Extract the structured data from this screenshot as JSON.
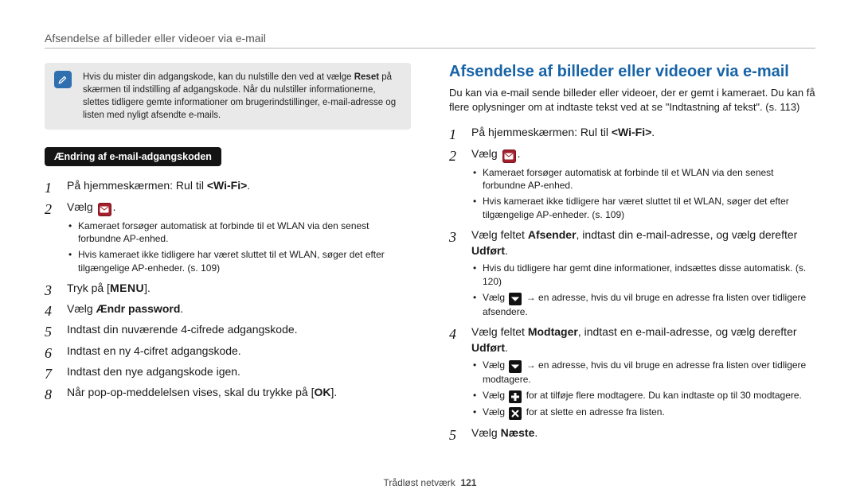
{
  "header": {
    "title": "Afsendelse af billeder eller videoer via e-mail"
  },
  "note": {
    "text": "Hvis du mister din adgangskode, kan du nulstille den ved at vælge ",
    "reset_word": "Reset",
    "text2": " på skærmen til indstilling af adgangskode. Når du nulstiller informationerne, slettes tidligere gemte informationer om brugerindstillinger, e-mail-adresse og listen med nyligt afsendte e-mails."
  },
  "section_pill": "Ændring af e-mail-adgangskoden",
  "left": {
    "s1_a": "På hjemmeskærmen: Rul til ",
    "s1_b": "<Wi-Fi>",
    "s1_c": ".",
    "s2": "Vælg ",
    "s2_suffix": ".",
    "bul1": "Kameraet forsøger automatisk at forbinde til et WLAN via den senest forbundne AP-enhed.",
    "bul2": "Hvis kameraet ikke tidligere har været sluttet til et WLAN, søger det efter tilgængelige AP-enheder. (s. 109)",
    "s3_a": "Tryk på [",
    "s3_menu": "MENU",
    "s3_b": "].",
    "s4_a": "Vælg ",
    "s4_b": "Ændr password",
    "s4_c": ".",
    "s5": "Indtast din nuværende 4-cifrede adgangskode.",
    "s6": "Indtast en ny 4-cifret adgangskode.",
    "s7": "Indtast den nye adgangskode igen.",
    "s8_a": "Når pop-op-meddelelsen vises, skal du trykke på [",
    "s8_ok": "OK",
    "s8_b": "]."
  },
  "right": {
    "heading": "Afsendelse af billeder eller videoer via e-mail",
    "intro": "Du kan via e-mail sende billeder eller videoer, der er gemt i kameraet. Du kan få flere oplysninger om at indtaste tekst ved at se \"Indtastning af tekst\". (s. 113)",
    "s1_a": "På hjemmeskærmen: Rul til ",
    "s1_b": "<Wi-Fi>",
    "s1_c": ".",
    "s2": "Vælg ",
    "s2_suffix": ".",
    "bul1": "Kameraet forsøger automatisk at forbinde til et WLAN via den senest forbundne AP-enhed.",
    "bul2": "Hvis kameraet ikke tidligere har været sluttet til et WLAN, søger det efter tilgængelige AP-enheder. (s. 109)",
    "s3_a": "Vælg feltet ",
    "s3_b": "Afsender",
    "s3_c": ", indtast din e-mail-adresse, og vælg derefter ",
    "s3_d": "Udført",
    "s3_e": ".",
    "s3_bul1": "Hvis du tidligere har gemt dine informationer, indsættes disse automatisk. (s. 120)",
    "s3_bul2a": "Vælg ",
    "s3_bul2b": " → en adresse, hvis du vil bruge en adresse fra listen over tidligere afsendere.",
    "s4_a": "Vælg feltet ",
    "s4_b": "Modtager",
    "s4_c": ", indtast en e-mail-adresse, og vælg derefter ",
    "s4_d": "Udført",
    "s4_e": ".",
    "s4_bul1a": "Vælg ",
    "s4_bul1b": " → en adresse, hvis du vil bruge en adresse fra listen over tidligere modtagere.",
    "s4_bul2a": "Vælg ",
    "s4_bul2b": " for at tilføje flere modtagere. Du kan indtaste op til 30 modtagere.",
    "s4_bul3a": "Vælg ",
    "s4_bul3b": " for at slette en adresse fra listen.",
    "s5_a": "Vælg ",
    "s5_b": "Næste",
    "s5_c": "."
  },
  "footer": {
    "section": "Trådløst netværk",
    "page": "121"
  }
}
